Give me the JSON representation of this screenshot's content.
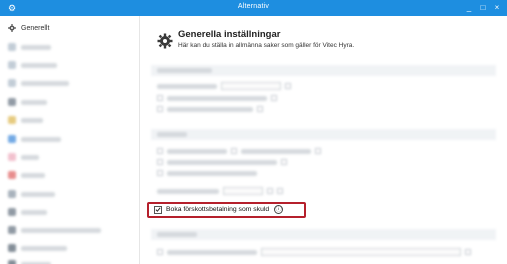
{
  "window": {
    "title": "Alternativ",
    "controls": {
      "minimize": "_",
      "maximize": "□",
      "close": "×"
    }
  },
  "sidebar": {
    "active_item": {
      "label": "Generellt",
      "icon": "gear-icon"
    }
  },
  "main": {
    "title": "Generella inställningar",
    "subtitle": "Här kan du ställa in allmänna saker som gäller för Vitec Hyra.",
    "highlighted_option": {
      "label": "Boka förskottsbetalning som skuld",
      "checked": true,
      "info_icon": "ⓘ"
    }
  },
  "colors": {
    "titlebar": "#1e8ee0",
    "highlight_border": "#b5202c"
  }
}
